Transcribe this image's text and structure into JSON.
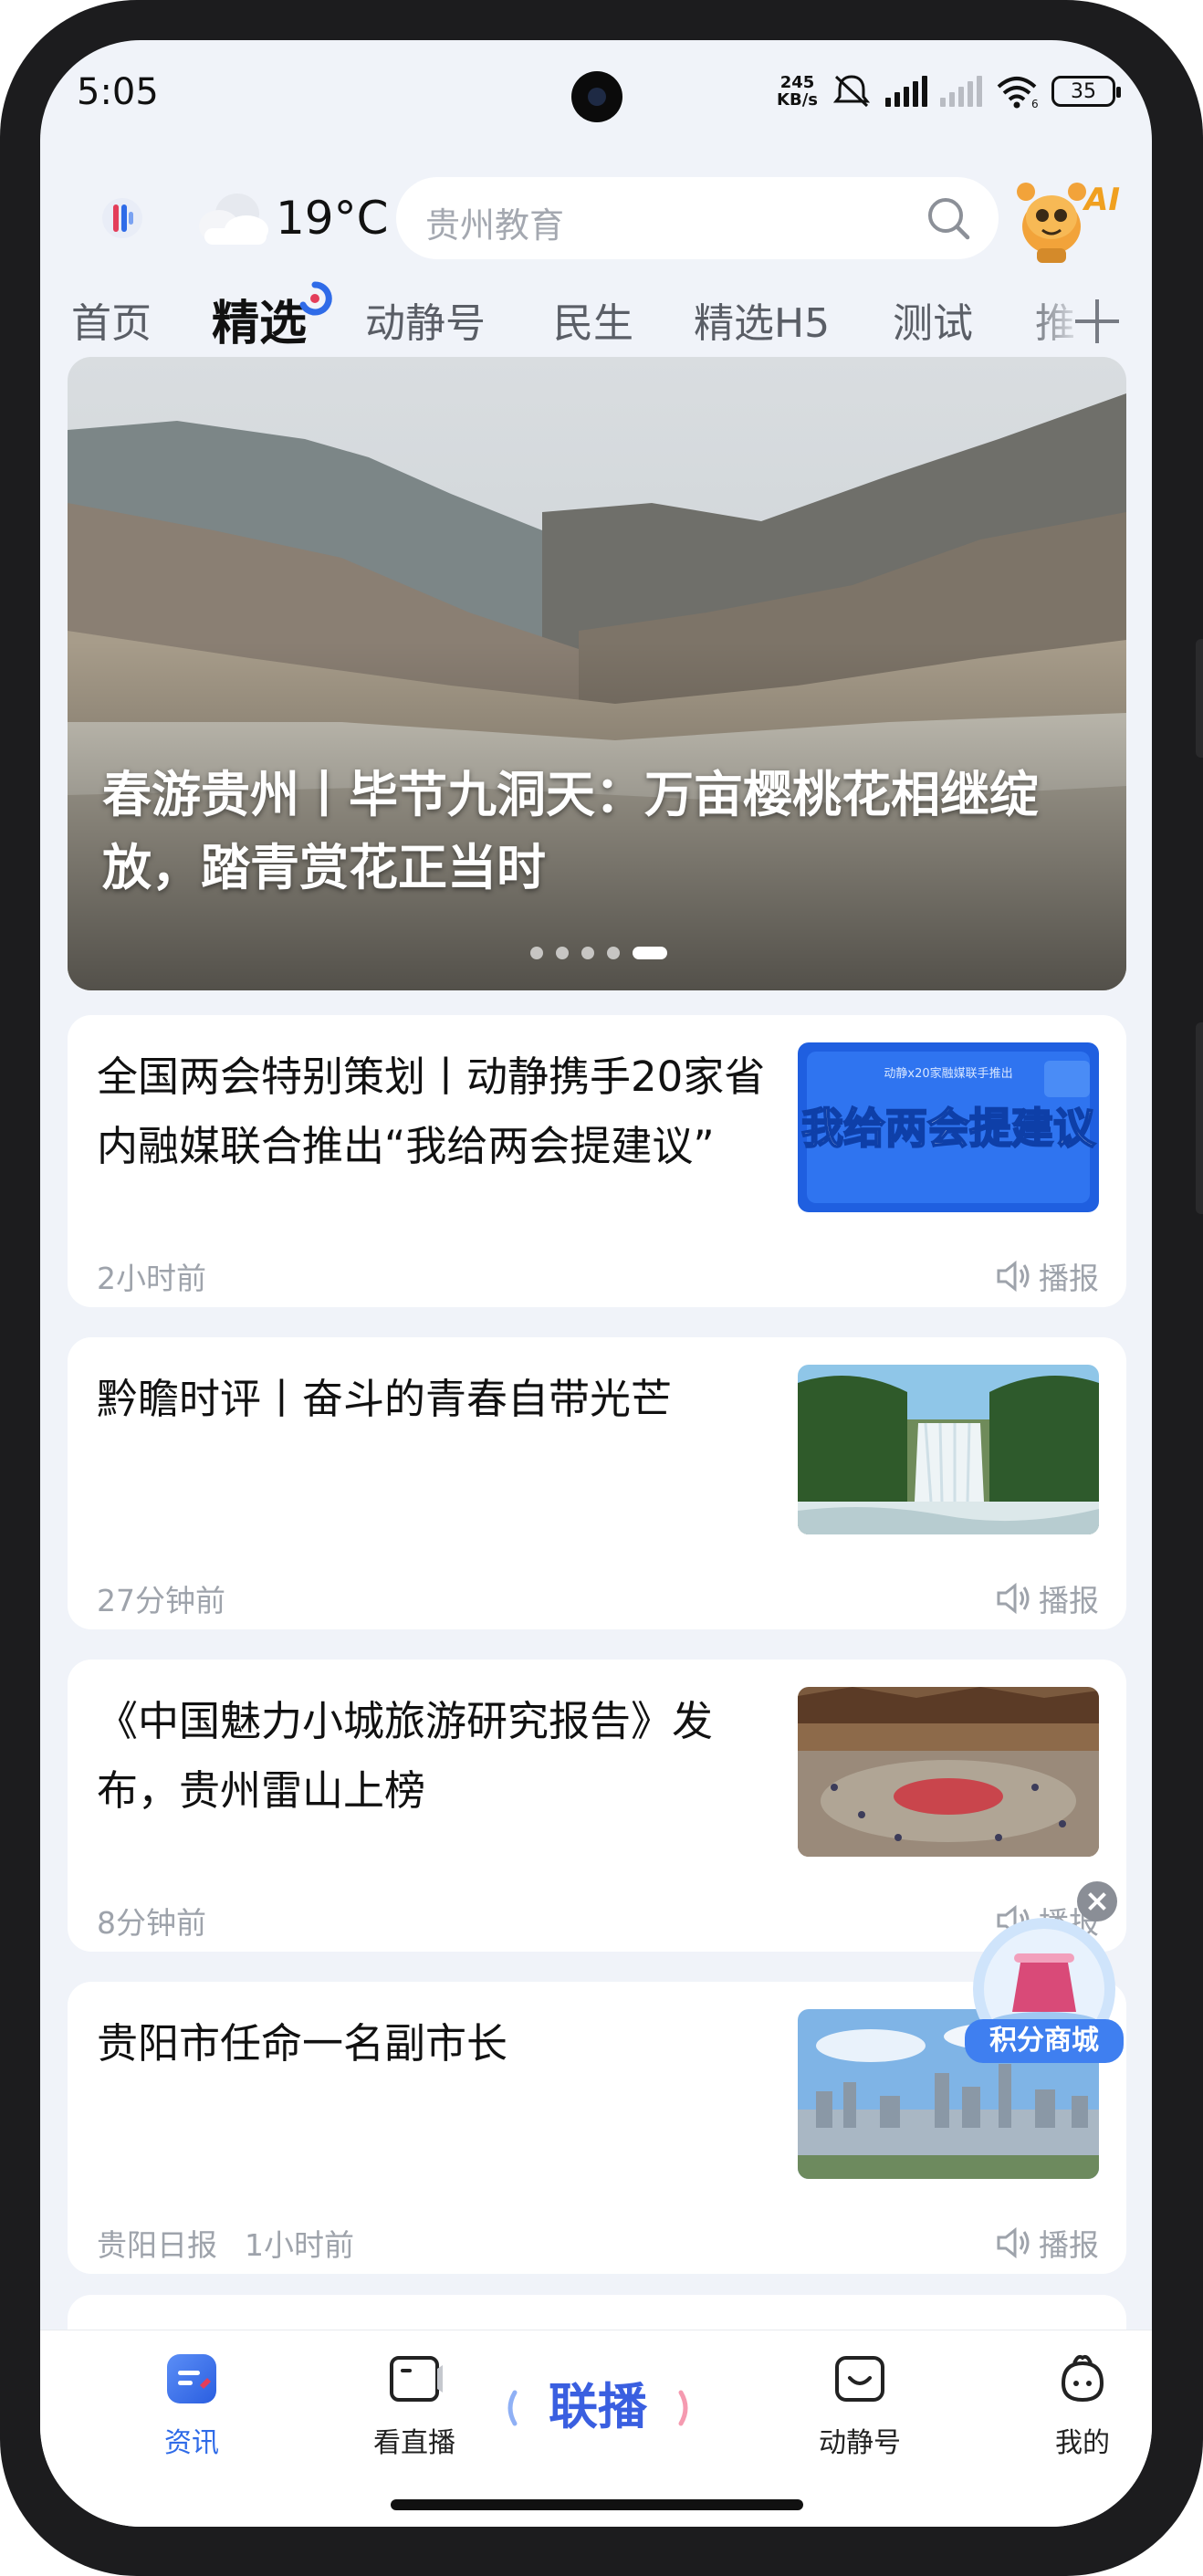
{
  "status_bar": {
    "time": "5:05",
    "net_speed_value": "245",
    "net_speed_unit": "KB/s",
    "wifi_label": "6",
    "battery": "35"
  },
  "header": {
    "temperature": "19°C",
    "search_placeholder": "贵州教育",
    "ai_label": "AI"
  },
  "tabs": [
    "首页",
    "精选",
    "动静号",
    "民生",
    "精选H5",
    "测试",
    "推"
  ],
  "active_tab_index": 1,
  "banner": {
    "title": "春游贵州丨毕节九洞天：万亩樱桃花相继绽放，踏青赏花正当时",
    "slide_count": 5,
    "active_slide": 5
  },
  "news": [
    {
      "title": "全国两会特别策划丨动静携手20家省内融媒联合推出“我给两会提建议”",
      "source": "",
      "time": "2小时前",
      "speak": "播报",
      "thumb": "promo-banner",
      "thumb_text": "我给两会提建议",
      "thumb_small": "动静x20家融媒联手推出"
    },
    {
      "title": "黔瞻时评丨奋斗的青春自带光芒",
      "source": "",
      "time": "27分钟前",
      "speak": "播报",
      "thumb": "waterfall"
    },
    {
      "title": "《中国魅力小城旅游研究报告》发布，贵州雷山上榜",
      "source": "",
      "time": "8分钟前",
      "speak": "播报",
      "thumb": "festival-crowd"
    },
    {
      "title": "贵阳市任命一名副市长",
      "source": "贵阳日报",
      "time": "1小时前",
      "speak": "播报",
      "thumb": "city-skyline"
    }
  ],
  "floating": {
    "label": "积分商城"
  },
  "bottom_nav": [
    {
      "label": "资讯",
      "icon": "news-icon",
      "active": true
    },
    {
      "label": "看直播",
      "icon": "live-tv-icon",
      "active": false
    },
    {
      "label": "联播",
      "icon": "broadcast-logo",
      "active": false
    },
    {
      "label": "动静号",
      "icon": "dongjing-icon",
      "active": false
    },
    {
      "label": "我的",
      "icon": "profile-icon",
      "active": false
    }
  ],
  "colors": {
    "accent": "#2f6be8",
    "background": "#f0f3f9",
    "text_primary": "#111111",
    "text_meta": "#9ea3ab"
  }
}
